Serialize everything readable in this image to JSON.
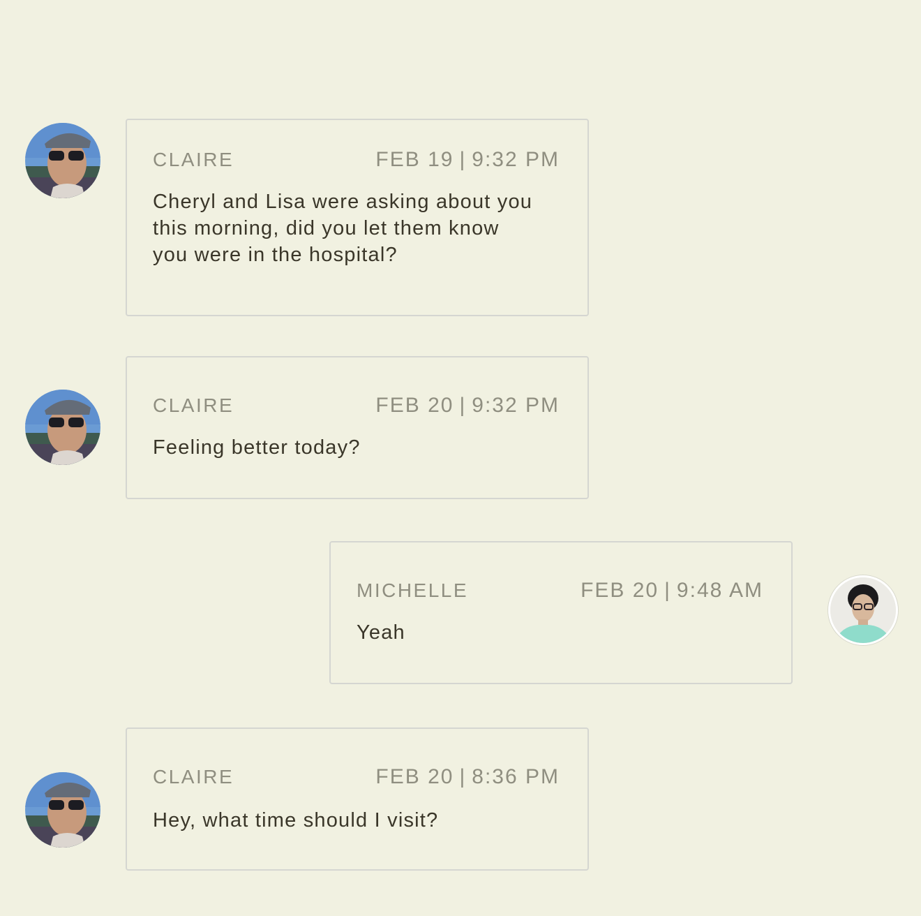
{
  "messages": [
    {
      "sender": "CLAIRE",
      "date": "FEB 19",
      "time": "9:32 PM",
      "text": "Cheryl and Lisa were asking about you this morning, did you let them know you were in the hospital?",
      "side": "left"
    },
    {
      "sender": "CLAIRE",
      "date": "FEB 20",
      "time": "9:32 PM",
      "text": "Feeling better today?",
      "side": "left"
    },
    {
      "sender": "MICHELLE",
      "date": "FEB 20",
      "time": "9:48 AM",
      "text": "Yeah",
      "side": "right"
    },
    {
      "sender": "CLAIRE",
      "date": "FEB 20",
      "time": "8:36 PM",
      "text": "Hey, what time should I visit?",
      "side": "left"
    }
  ],
  "separator": "|",
  "colors": {
    "background": "#f1f1e1",
    "border": "#d5d6d1",
    "meta_text": "#8f8e80",
    "body_text": "#3a3629"
  }
}
